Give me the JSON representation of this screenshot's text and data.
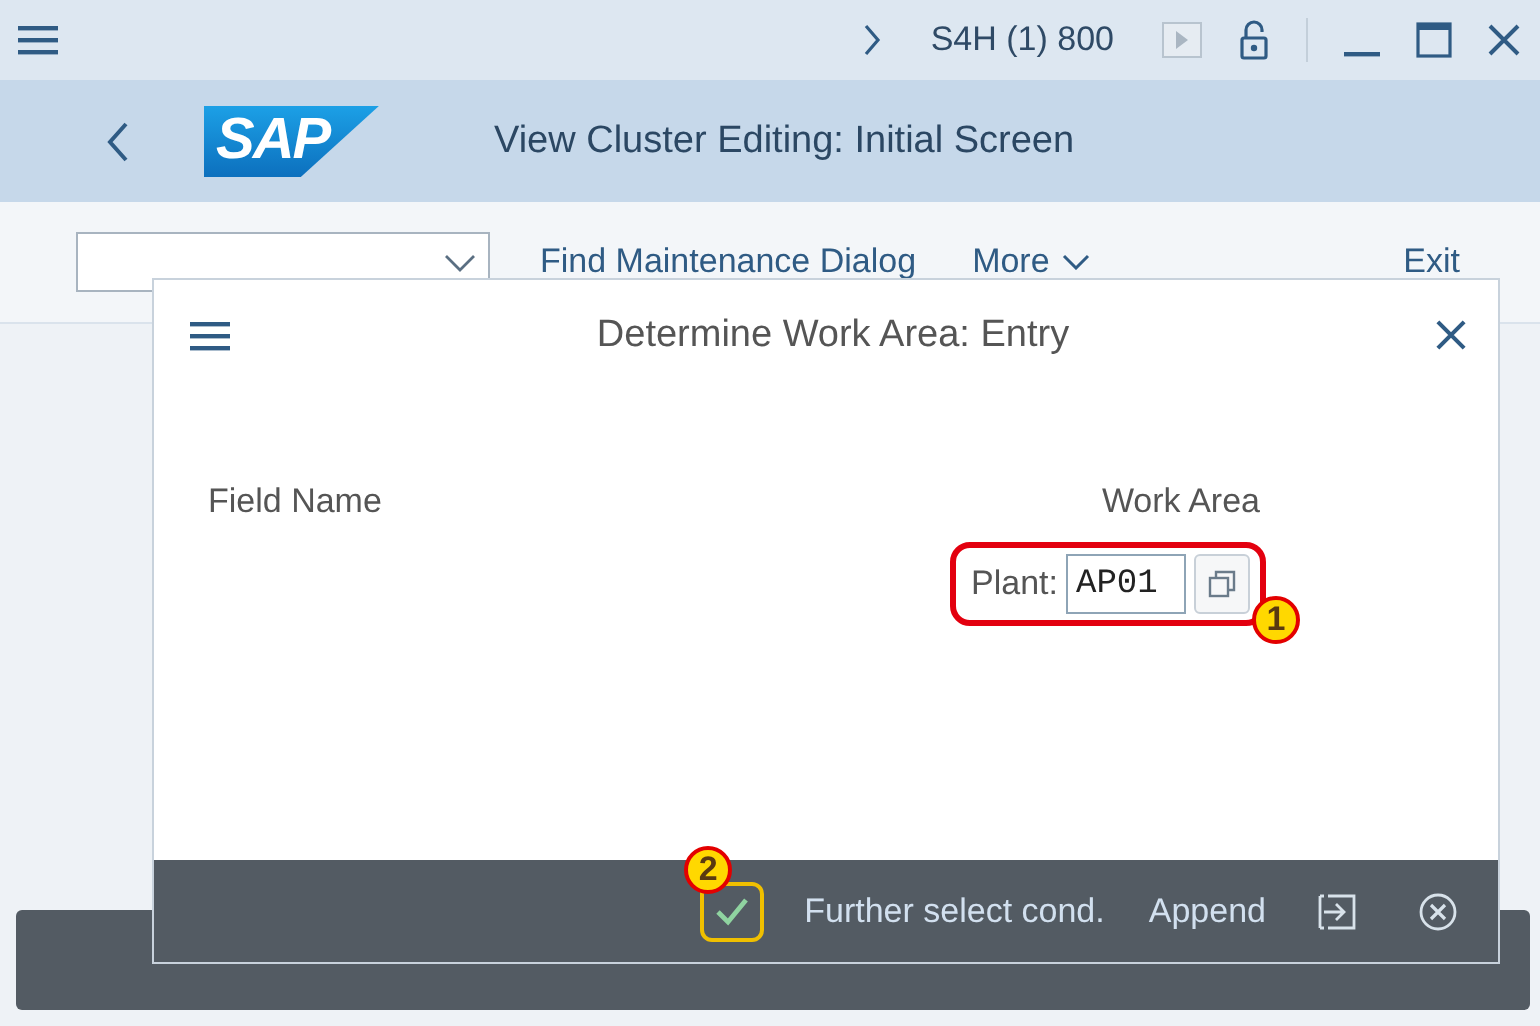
{
  "window": {
    "system": "S4H (1) 800"
  },
  "header": {
    "logo": "SAP",
    "title": "View Cluster Editing: Initial Screen"
  },
  "toolbar": {
    "items": [
      {
        "label": "Find Maintenance Dialog",
        "kind": "link"
      },
      {
        "label": "More",
        "kind": "menu"
      }
    ],
    "exit": "Exit"
  },
  "dialog": {
    "title": "Determine Work Area: Entry",
    "columns": [
      "Field Name",
      "Work Area"
    ],
    "fields": [
      {
        "label": "Plant:",
        "value": "AP01"
      }
    ],
    "footer": [
      {
        "kind": "check"
      },
      {
        "kind": "text",
        "label": "Further select cond."
      },
      {
        "kind": "text",
        "label": "Append"
      },
      {
        "kind": "import"
      },
      {
        "kind": "cancel"
      }
    ]
  },
  "annotations": [
    {
      "number": "1"
    },
    {
      "number": "2"
    }
  ]
}
